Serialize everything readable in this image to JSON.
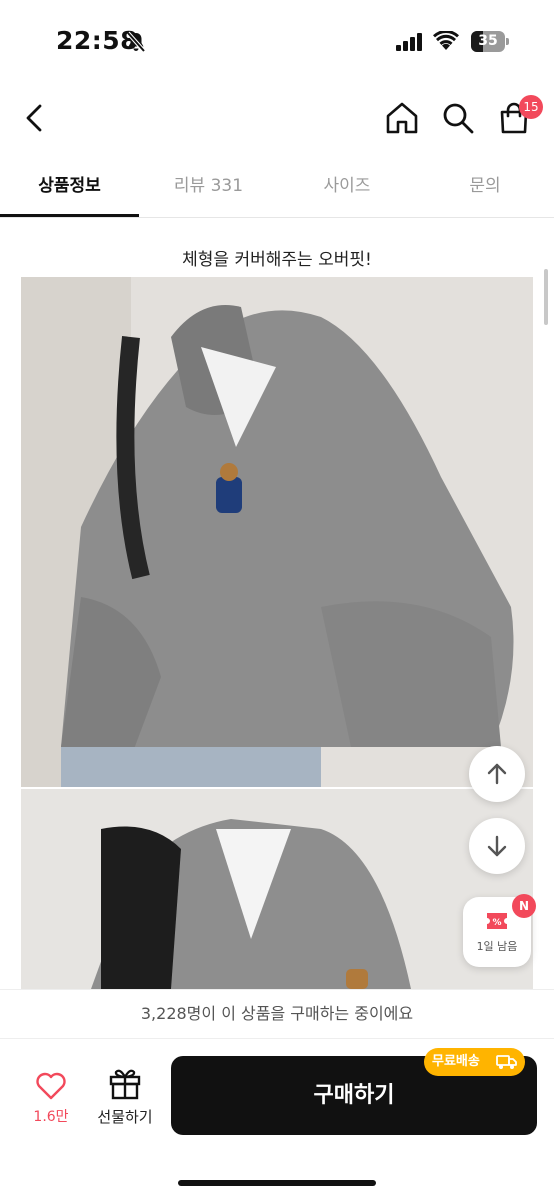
{
  "status_bar": {
    "time": "22:58",
    "battery": "35"
  },
  "nav": {
    "cart_count": "15"
  },
  "tabs": [
    {
      "label": "상품정보"
    },
    {
      "label": "리뷰 331"
    },
    {
      "label": "사이즈"
    },
    {
      "label": "문의"
    }
  ],
  "content": {
    "headline": "체형을 커버해주는 오버핏!"
  },
  "coupon": {
    "badge": "N",
    "label": "1일 남음"
  },
  "buyers_banner": "3,228명이 이 상품을 구매하는 중이에요",
  "bottom_bar": {
    "like_count": "1.6만",
    "gift_label": "선물하기",
    "buy_label": "구매하기",
    "shipping_badge": "무료배송"
  },
  "colors": {
    "accent_red": "#f2495b",
    "shipping_yellow": "#ffb400",
    "buy_black": "#111111"
  }
}
